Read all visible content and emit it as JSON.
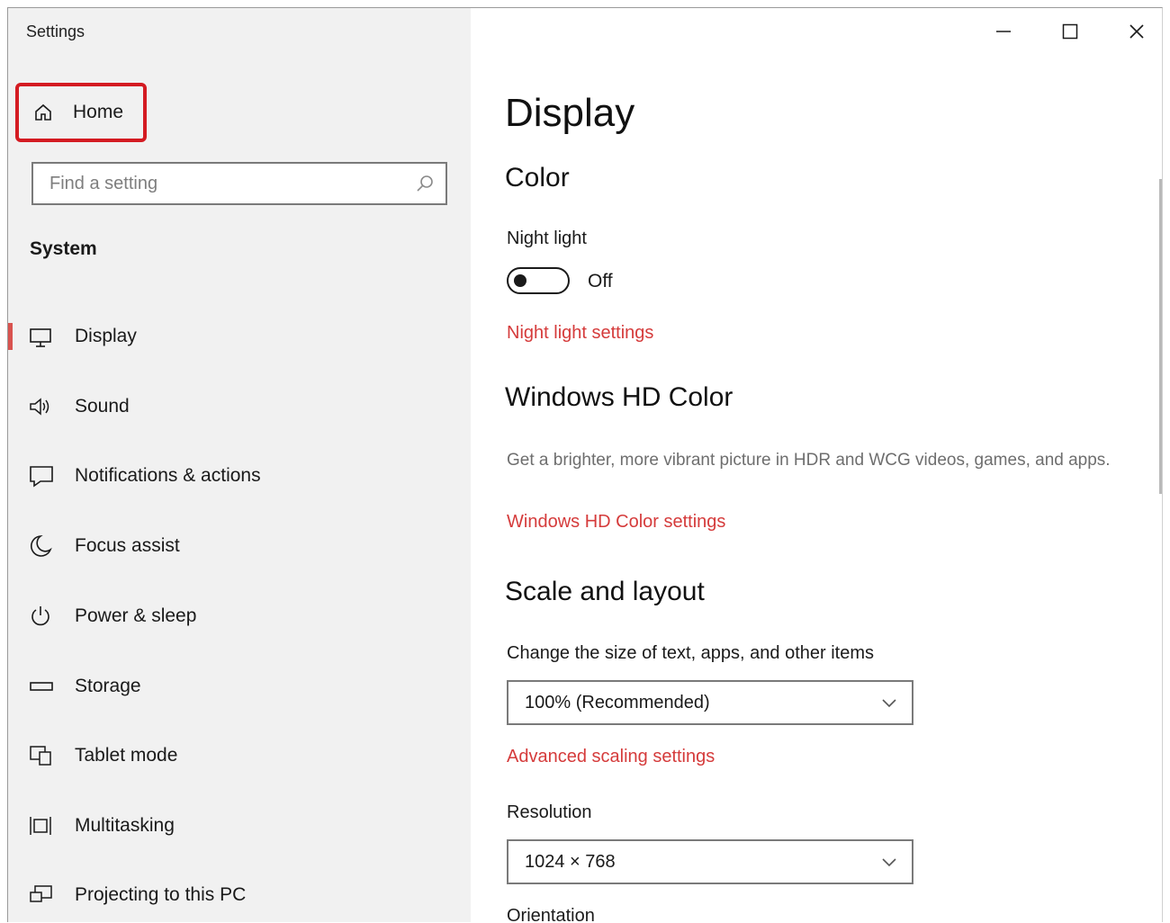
{
  "window": {
    "title": "Settings",
    "controls": {
      "minimize": "minimize-icon",
      "maximize": "maximize-icon",
      "close": "close-icon"
    }
  },
  "sidebar": {
    "home_label": "Home",
    "search_placeholder": "Find a setting",
    "section_title": "System",
    "items": [
      {
        "label": "Display",
        "icon": "monitor-icon",
        "selected": true
      },
      {
        "label": "Sound",
        "icon": "speaker-icon"
      },
      {
        "label": "Notifications & actions",
        "icon": "notification-icon"
      },
      {
        "label": "Focus assist",
        "icon": "moon-icon"
      },
      {
        "label": "Power & sleep",
        "icon": "power-icon"
      },
      {
        "label": "Storage",
        "icon": "storage-icon"
      },
      {
        "label": "Tablet mode",
        "icon": "tablet-mode-icon"
      },
      {
        "label": "Multitasking",
        "icon": "multitasking-icon"
      },
      {
        "label": "Projecting to this PC",
        "icon": "projecting-icon"
      }
    ]
  },
  "main": {
    "page_title": "Display",
    "color": {
      "heading": "Color",
      "night_light_label": "Night light",
      "night_light_state": "Off",
      "night_light_link": "Night light settings"
    },
    "hd_color": {
      "heading": "Windows HD Color",
      "description": "Get a brighter, more vibrant picture in HDR and WCG videos, games, and apps.",
      "link": "Windows HD Color settings"
    },
    "scale": {
      "heading": "Scale and layout",
      "size_label": "Change the size of text, apps, and other items",
      "size_value": "100% (Recommended)",
      "advanced_link": "Advanced scaling settings",
      "resolution_label": "Resolution",
      "resolution_value": "1024 × 768",
      "orientation_label": "Orientation"
    }
  },
  "colors": {
    "highlight_border": "#d41b22",
    "link": "#d53b3b",
    "selected_indicator": "#d9534f",
    "sidebar_bg": "#f1f1f1"
  }
}
